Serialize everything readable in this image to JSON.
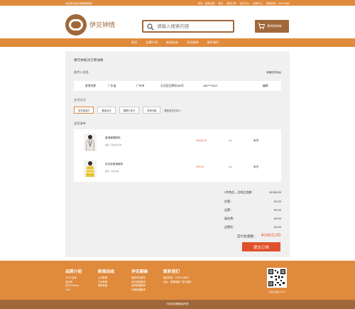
{
  "topbar": {
    "welcome": "欢迎来到伊见倩情服装城！",
    "links": [
      "你好，香港克斯",
      "退出",
      "我的订单",
      "会员中心",
      "卖家中心",
      "客服热线：4000-8888"
    ]
  },
  "header": {
    "brand": "伊见钟情",
    "search_placeholder": "请输入搜索内容",
    "cart_label": "我的购物车"
  },
  "nav": {
    "items": [
      "首页",
      "品牌介绍",
      "新闻动态",
      "伊见服装",
      "联系我们"
    ]
  },
  "page": {
    "title": "填写并核对订单详情",
    "receiver_title": "收件人信息",
    "new_address": "新增收货地址",
    "address": {
      "name": "香港克斯",
      "province": "广东省",
      "city": "广州市",
      "street": "天河区石牌桥365号",
      "phone": "186****5307",
      "edit": "编辑"
    },
    "payment_title": "支付方式",
    "payments": [
      "支付宝支付",
      "微信支付",
      "银联卡支付",
      "货到付款"
    ],
    "payment_selected": 0,
    "more_payments": "更多支付方式>>",
    "list_title": "送货清单",
    "items": [
      {
        "name": "香港潮情服饰",
        "sub": "颜色：黑白色/长款",
        "price": "¥1528.00",
        "qty": "×1",
        "stock": "有货"
      },
      {
        "name": "伊见钟香港服饰",
        "sub": "颜色：黄白条纹",
        "price": "¥75.00",
        "qty": "×1",
        "stock": "有货"
      }
    ],
    "summary": [
      {
        "label": "2件商品，总商品金额：",
        "value": "¥1538.00"
      },
      {
        "label": "优惠：",
        "value": "¥2.00"
      },
      {
        "label": "运费：",
        "value": "¥0.00"
      },
      {
        "label": "服务费：",
        "value": "¥0.00"
      },
      {
        "label": "运费险：",
        "value": "¥0.00"
      }
    ],
    "total_label": "应付总金额：",
    "total_value": "¥1603.00",
    "submit_label": "提交订单"
  },
  "footer": {
    "cols": [
      {
        "title": "品牌介绍",
        "lines": [
          "CK3C店面",
          "金利来",
          "圣贝尔Samsi",
          "C&A"
        ]
      },
      {
        "title": "新闻动态",
        "lines": [
          "公司新闻",
          "行业新闻",
          "媒体新闻"
        ]
      },
      {
        "title": "伊见服装",
        "lines": [
          "最新伊见服饰",
          "伊见潮流服饰",
          "城邦新潮服饰",
          "华美新潮服饰"
        ]
      },
      {
        "title": "联系我们",
        "lines": [
          "服务热线：12654-45556",
          "地址：香港服装厂官方直营"
        ]
      }
    ],
    "qr_caption": "扫码关注微信公众号",
    "copyright": "©伊见钟情版权所有"
  },
  "colors": {
    "accent": "#e08a3c",
    "brown": "#a0683a",
    "price": "#e05a2b",
    "submit": "#e0502a"
  },
  "icons": [
    "logo-icon",
    "search-icon",
    "cart-icon",
    "qr-code-icon"
  ]
}
